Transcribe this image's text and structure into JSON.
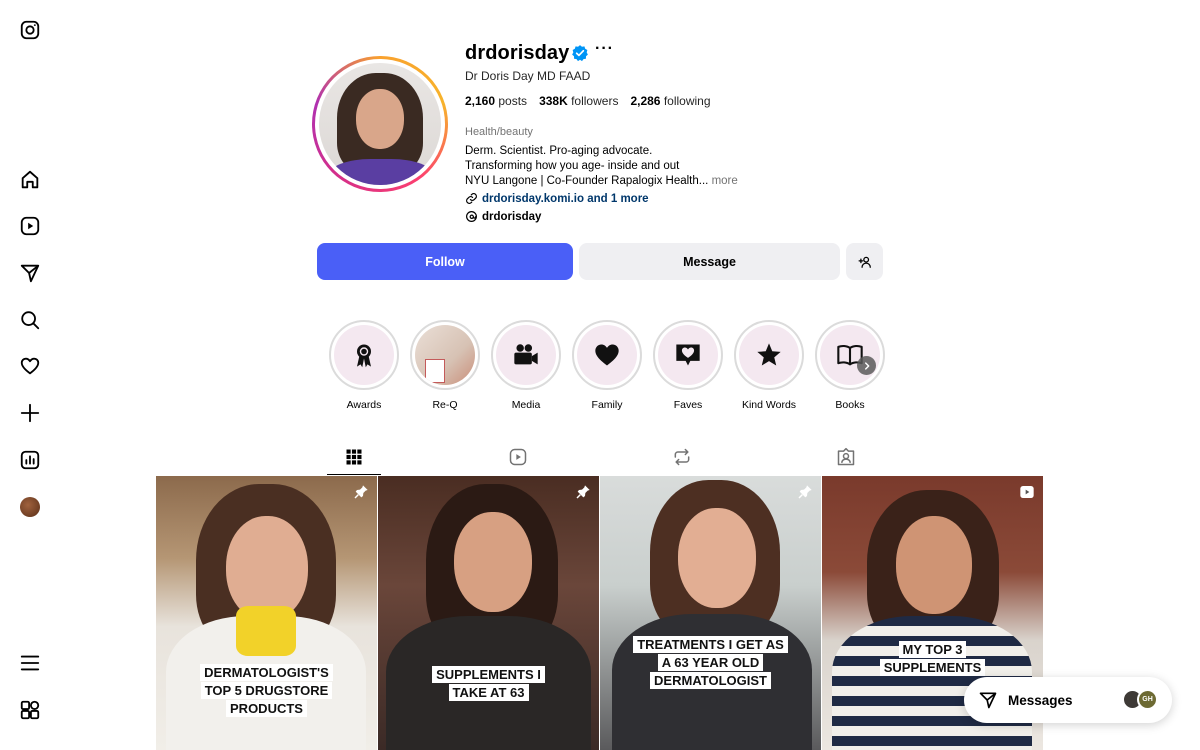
{
  "nav": {
    "items": [
      "instagram-logo",
      "home",
      "reels",
      "messages",
      "search",
      "notifications",
      "create",
      "insights",
      "profile",
      "more",
      "also-from-meta"
    ]
  },
  "profile": {
    "username": "drdorisday",
    "full_name": "Dr Doris Day MD FAAD",
    "posts_count": "2,160",
    "posts_label": "posts",
    "followers_count": "338K",
    "followers_label": "followers",
    "following_count": "2,286",
    "following_label": "following",
    "category": "Health/beauty",
    "bio_line1": "Derm. Scientist. Pro-aging advocate.",
    "bio_line2": "Transforming how you age- inside and out",
    "bio_line3": "NYU Langone | Co-Founder Rapalogix Health...",
    "bio_more": "more",
    "link_text": "drdorisday.komi.io and 1 more",
    "threads_handle": "drdorisday",
    "verified": true
  },
  "actions": {
    "follow_label": "Follow",
    "message_label": "Message",
    "follow_color": "#4a5ff7"
  },
  "highlights": [
    {
      "label": "Awards",
      "icon": "award-ribbon-icon"
    },
    {
      "label": "Re-Q",
      "icon": "photo"
    },
    {
      "label": "Media",
      "icon": "video-camera-icon"
    },
    {
      "label": "Family",
      "icon": "heart-icon"
    },
    {
      "label": "Faves",
      "icon": "heart-message-icon"
    },
    {
      "label": "Kind Words",
      "icon": "star-icon"
    },
    {
      "label": "Books",
      "icon": "open-book-icon"
    }
  ],
  "tabs": [
    "posts-grid",
    "reels",
    "reposts",
    "tagged"
  ],
  "posts": [
    {
      "caption": "Dermatologist's top 5 drugstore products",
      "badge": "pin-icon"
    },
    {
      "caption": "Supplements I take at 63",
      "badge": "pin-icon"
    },
    {
      "caption": "Treatments I get as a 63 year old dermatologist",
      "badge": "pin-icon"
    },
    {
      "caption": "My top 3 supplements",
      "badge": "reel-icon"
    }
  ],
  "messages_pill": {
    "label": "Messages",
    "avatar2_initials": "GH"
  }
}
